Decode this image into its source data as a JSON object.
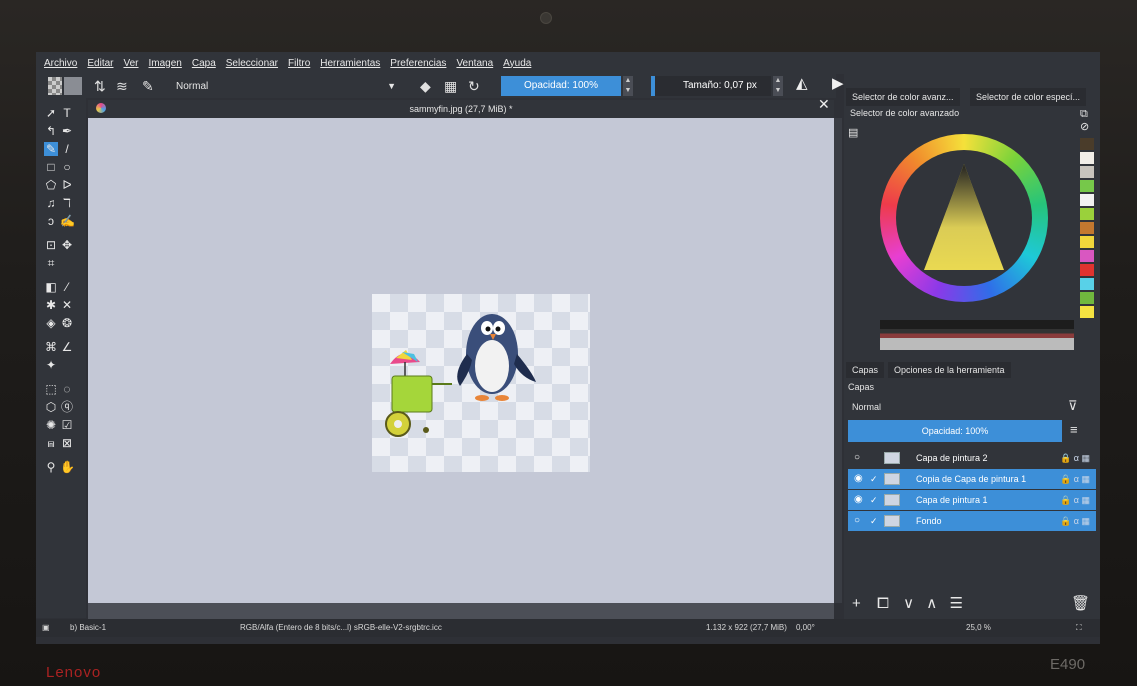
{
  "device": {
    "brand_left": "Lenovo",
    "brand_right": "E490"
  },
  "menu": [
    "Archivo",
    "Editar",
    "Ver",
    "Imagen",
    "Capa",
    "Seleccionar",
    "Filtro",
    "Herramientas",
    "Preferencias",
    "Ventana",
    "Ayuda"
  ],
  "toolbar": {
    "blend_mode": "Normal",
    "opacity": "Opacidad: 100%",
    "size": "Tamaño: 0,07 px"
  },
  "document": {
    "tab_title": "sammyfin.jpg (27,7 MiB) *"
  },
  "dock": {
    "tabs": [
      "Selector de color avanz...",
      "Selector de color especí..."
    ],
    "color_title": "Selector de color avanzado",
    "palette": [
      "#4a3c2a",
      "#f1eee8",
      "#c8c4bd",
      "#76c84a",
      "#f2f2f2",
      "#9ad13b",
      "#c3782f",
      "#f0d63b",
      "#d957c1",
      "#e0332f",
      "#58d1e8",
      "#70b83e",
      "#f4e241"
    ]
  },
  "layers": {
    "tabs": [
      "Capas",
      "Opciones de la herramienta"
    ],
    "title": "Capas",
    "blend": "Normal",
    "opacity": "Opacidad: 100%",
    "rows": [
      {
        "name": "Capa de pintura 2",
        "visible": false,
        "selected": false
      },
      {
        "name": "Copia de Capa de pintura 1",
        "visible": true,
        "selected": true
      },
      {
        "name": "Capa de pintura 1",
        "visible": true,
        "selected": true
      },
      {
        "name": "Fondo",
        "visible": false,
        "selected": true
      }
    ]
  },
  "status": {
    "brush": "b) Basic-1",
    "color_profile": "RGB/Alfa (Entero de 8 bits/c...l)  sRGB-elle-V2-srgbtrc.icc",
    "dimensions": "1.132 x 922 (27,7 MiB)",
    "rotation": "0,00°",
    "zoom": "25,0 %"
  }
}
